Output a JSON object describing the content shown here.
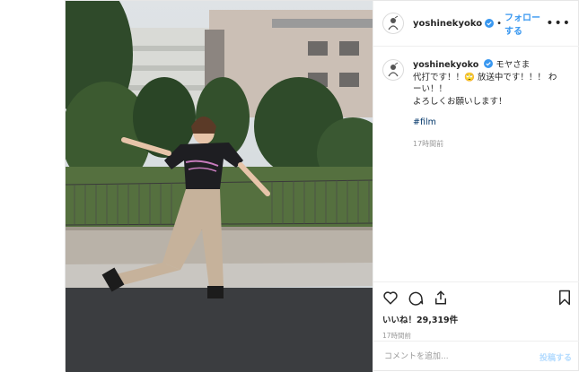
{
  "header": {
    "username": "yoshinekyoko",
    "separator": "•",
    "follow_label": "フォロー する",
    "more_label": "•••"
  },
  "caption": {
    "username": "yoshinekyoko",
    "greeting": "モヤさま",
    "lines": [
      "代打です！！🙄 放送中です！！！ わ",
      "ーい！！",
      "よろしくお願いします！"
    ],
    "hashtag": "#film",
    "time": "17時間前"
  },
  "actions": {
    "icons": [
      "heart-icon",
      "comment-icon",
      "share-icon",
      "bookmark-icon"
    ],
    "likes": "いいね！29,319件",
    "time": "17時間前"
  },
  "comment": {
    "placeholder": "コメントを追加...",
    "post_label": "投稿する"
  },
  "colors": {
    "accent": "#3897f0",
    "verified": "#3897f0",
    "post_disabled": "#b3dbff"
  }
}
